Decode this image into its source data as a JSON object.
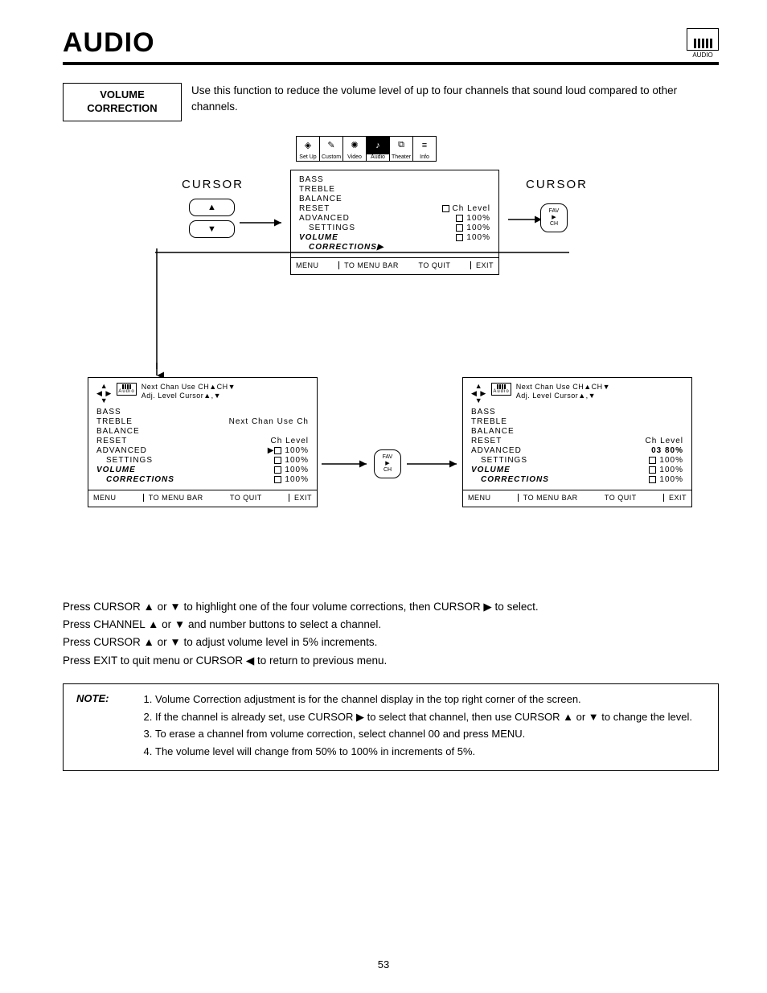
{
  "header": {
    "title": "AUDIO",
    "iconLabel": "AUDIO"
  },
  "section": {
    "label": "VOLUME CORRECTION",
    "desc": "Use this function to reduce the volume level of up to four channels that sound loud compared to other channels."
  },
  "menuBar": [
    {
      "name": "setup",
      "label": "Set Up",
      "glyph": "✦"
    },
    {
      "name": "custom",
      "label": "Custom",
      "glyph": "✎"
    },
    {
      "name": "video",
      "label": "Video",
      "glyph": "✺"
    },
    {
      "name": "audio",
      "label": "Audio",
      "glyph": "♪",
      "selected": true
    },
    {
      "name": "theater",
      "label": "Theater",
      "glyph": "⧉"
    },
    {
      "name": "info",
      "label": "Info",
      "glyph": "≡"
    }
  ],
  "cursorLabel": "CURSOR",
  "arrows": {
    "up": "▲",
    "down": "▼",
    "left": "◀",
    "right": "▶"
  },
  "fav": {
    "l1": "FAV",
    "l2": "▶",
    "l3": "CH"
  },
  "osd": {
    "items": [
      "BASS",
      "TREBLE",
      "BALANCE",
      "RESET",
      "ADVANCED",
      "SETTINGS",
      "VOLUME",
      "CORRECTIONS"
    ],
    "chLevel": "Ch Level",
    "pct100": "100%",
    "pct0380": "03 80%",
    "nextChan": "Next Chan Use Ch",
    "hint1": "Next Chan Use CH▲CH▼",
    "hint2": "Adj. Level Cursor▲,▼",
    "miniLabel": "Audio",
    "foot": {
      "m": "MENU",
      "tb": "TO MENU BAR",
      "tq": "TO QUIT",
      "ex": "EXIT"
    }
  },
  "instructions": [
    "Press CURSOR ▲ or ▼ to highlight one of the four volume corrections, then CURSOR ▶ to select.",
    "Press CHANNEL ▲ or ▼ and number buttons to select a channel.",
    "Press CURSOR ▲ or ▼ to adjust volume level in 5% increments.",
    "Press EXIT to quit menu or CURSOR ◀ to return to previous menu."
  ],
  "note": {
    "label": "NOTE:",
    "items": [
      "Volume Correction adjustment is for the channel display in the top right corner of the screen.",
      "If the channel is already set, use CURSOR ▶ to select that channel, then use CURSOR ▲ or ▼ to change the level.",
      "To erase a channel from volume correction, select channel 00 and press MENU.",
      "The volume level will change from 50% to 100% in increments of 5%."
    ]
  },
  "pageNumber": "53"
}
